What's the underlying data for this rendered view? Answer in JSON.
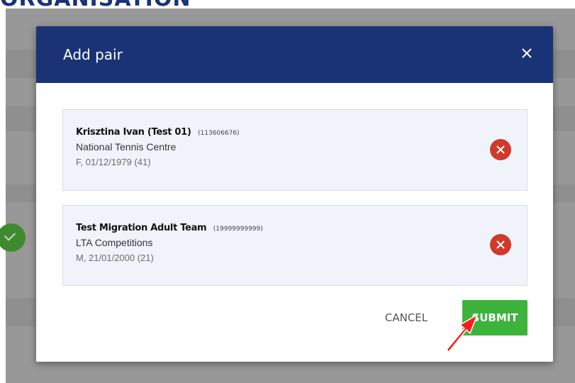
{
  "background": {
    "heading": "ORGANISATION",
    "check_icon": "check-circle-icon"
  },
  "modal": {
    "title": "Add pair",
    "close_icon": "close-icon"
  },
  "players": [
    {
      "name": "Krisztina Ivan (Test 01)",
      "id": "(113606676)",
      "club": "National Tennis Centre",
      "dob": "F, 01/12/1979 (41)"
    },
    {
      "name": "Test Migration Adult Team",
      "id": "(19999999999)",
      "club": "LTA Competitions",
      "dob": "M, 21/01/2000 (21)"
    }
  ],
  "actions": {
    "cancel_label": "CANCEL",
    "submit_label": "SUBMIT"
  },
  "colors": {
    "header": "#1a3376",
    "submit": "#3cb43c",
    "remove": "#cf3a2a",
    "card_bg": "#f0f4fa"
  }
}
